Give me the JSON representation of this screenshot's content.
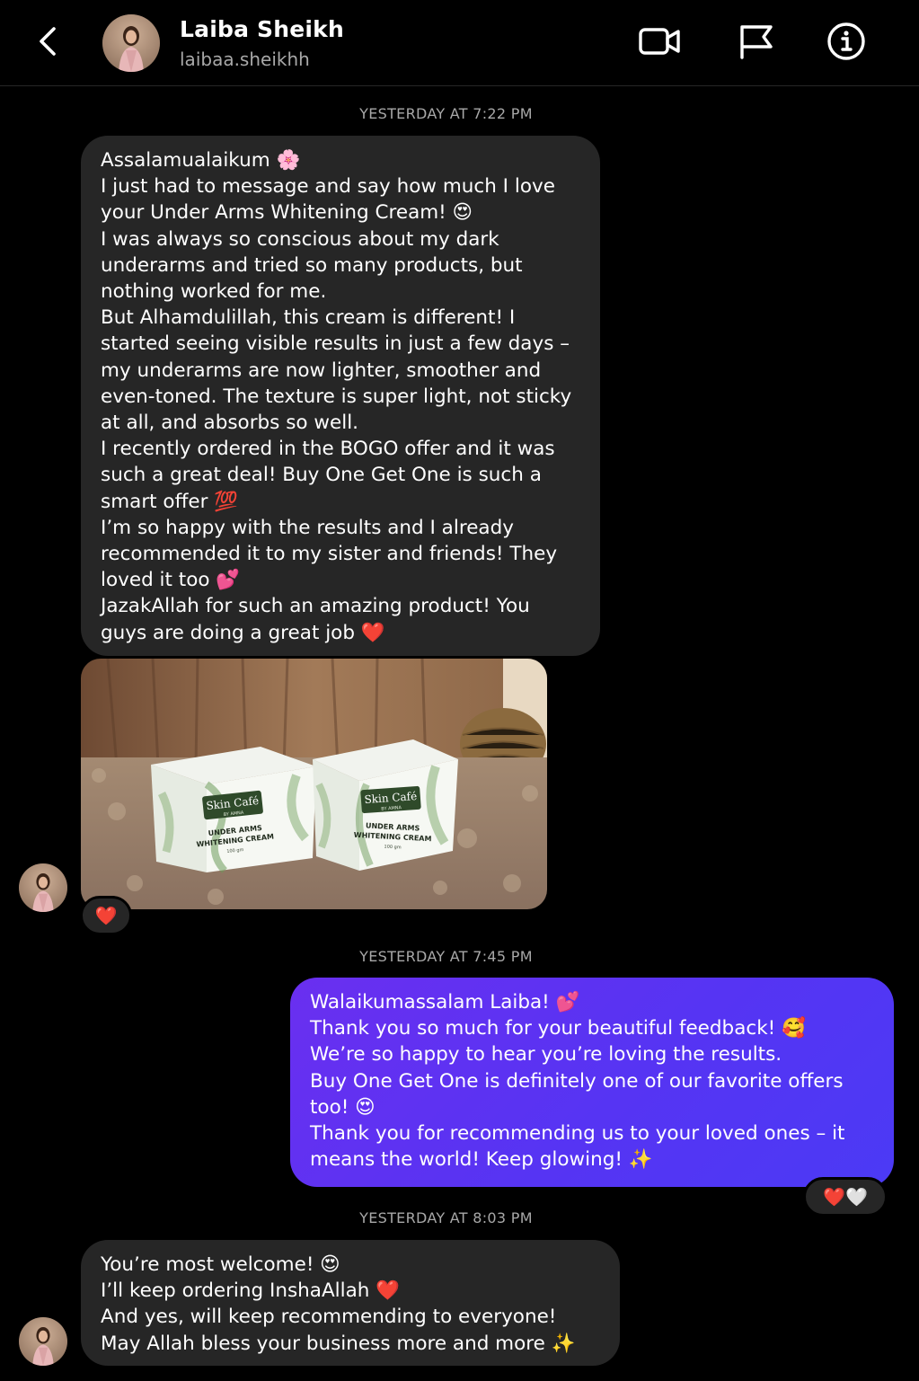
{
  "header": {
    "name": "Laiba Sheikh",
    "username": "laibaa.sheikhh",
    "icons": [
      "chevron-left-icon",
      "video-camera-icon",
      "flag-icon",
      "info-icon"
    ]
  },
  "messages": [
    {
      "timestamp": "YESTERDAY AT 7:22 PM",
      "text": "Assalamualaikum 🌸\nI just had to message and say how much I love your Under Arms Whitening Cream! 😍\nI was always so conscious about my dark underarms and tried so many products, but nothing worked for me.\nBut Alhamdulillah, this cream is different! I started seeing visible results in just a few days – my underarms are now lighter, smoother and even-toned. The texture is super light, not sticky at all, and absorbs so well.\nI recently ordered in the BOGO offer and it was such a great deal! Buy One Get One is such a smart offer 💯\nI’m so happy with the results and I already recommended it to my sister and friends! They loved it too 💕\nJazakAllah for such an amazing product! You guys are doing a great job ❤️"
    },
    {
      "photo": {
        "box_brand": "Skin Café",
        "box_sub": "BY AMNA",
        "box_product_line1": "UNDER ARMS",
        "box_product_line2": "WHITENING CREAM",
        "box_weight": "100 gm"
      },
      "reaction": "❤️"
    },
    {
      "timestamp": "YESTERDAY AT 7:45 PM",
      "text": "Walaikumassalam Laiba! 💕\nThank you so much for your beautiful feedback! 🥰\nWe’re so happy to hear you’re loving the results.\nBuy One Get One is definitely one of our favorite offers too! 😍\nThank you for recommending us to your loved ones – it means the world! Keep glowing! ✨",
      "reaction": "❤️🤍"
    },
    {
      "timestamp": "YESTERDAY AT 8:03 PM",
      "text": "You’re most welcome! 😍\nI’ll keep ordering InshaAllah ❤️\nAnd yes, will keep recommending to everyone!\nMay Allah bless your business more and more ✨"
    }
  ],
  "colors": {
    "background": "#000000",
    "incoming_bubble": "#262626",
    "outgoing_bubble_start": "#6a2ff0",
    "outgoing_bubble_end": "#4b3af5",
    "secondary_text": "#a8a8a8"
  }
}
